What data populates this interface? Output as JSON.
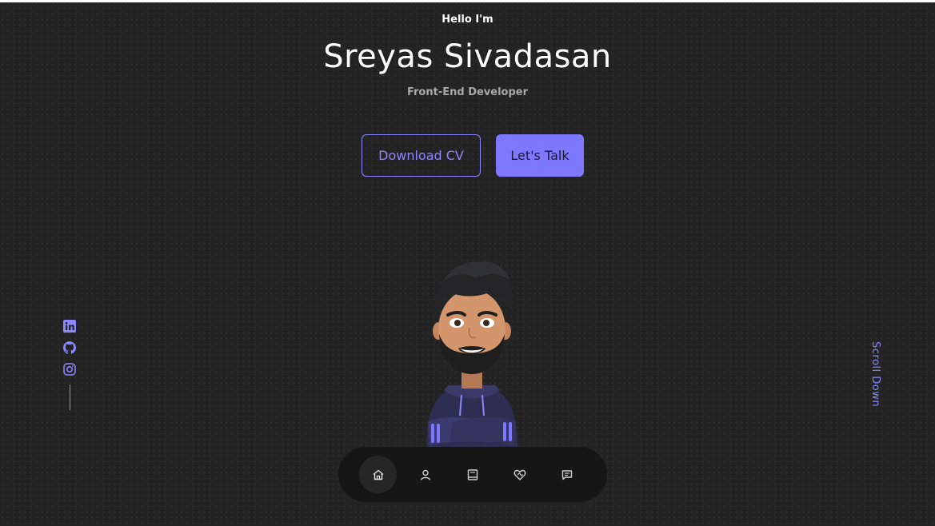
{
  "hero": {
    "greeting": "Hello I'm",
    "name": "Sreyas Sivadasan",
    "role": "Front-End Developer"
  },
  "buttons": {
    "download_cv": "Download CV",
    "lets_talk": "Let's Talk"
  },
  "scroll_label": "Scroll Down",
  "socials": [
    {
      "icon": "linkedin-icon"
    },
    {
      "icon": "github-icon"
    },
    {
      "icon": "instagram-icon"
    }
  ],
  "nav": [
    {
      "icon": "home-icon",
      "active": true
    },
    {
      "icon": "user-icon",
      "active": false
    },
    {
      "icon": "book-icon",
      "active": false
    },
    {
      "icon": "services-icon",
      "active": false
    },
    {
      "icon": "message-icon",
      "active": false
    }
  ],
  "colors": {
    "accent": "#8c86ff",
    "accent_fill": "#7d78ff",
    "background": "#232323",
    "nav_background": "#161616"
  }
}
